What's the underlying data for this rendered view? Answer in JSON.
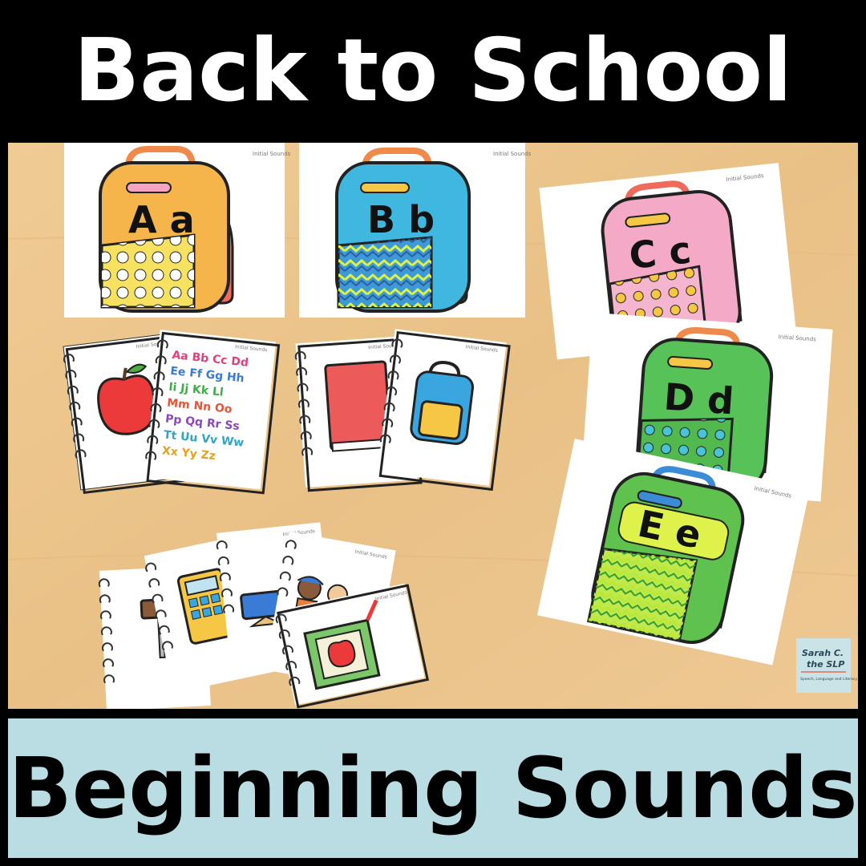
{
  "title": "Back to School",
  "subtitle": "Beginning Sounds",
  "cards": {
    "a": "A a",
    "b": "B b",
    "c": "C c",
    "d": "D d",
    "e": "E e",
    "card_header": "Initial Sounds"
  },
  "alphabet_lines": [
    "Aa Bb Cc Dd",
    "Ee Ff Gg Hh",
    "Ii Jj Kk Ll",
    "Mm Nn Oo",
    "Pp Qq Rr Ss",
    "Tt Uu Vv Ww",
    "Xx Yy Zz"
  ],
  "logo": {
    "line1": "Sarah C.",
    "line2": "the SLP",
    "tagline": "Speech, Language and Literacy"
  },
  "colors": {
    "table": "#ecc58c",
    "banner_bottom": "#b9dde2",
    "backpack_a": "#f6b54a",
    "backpack_b": "#3fb7df",
    "backpack_c": "#f4a9c7",
    "backpack_d": "#56c257",
    "backpack_e": "#5fc14e"
  }
}
